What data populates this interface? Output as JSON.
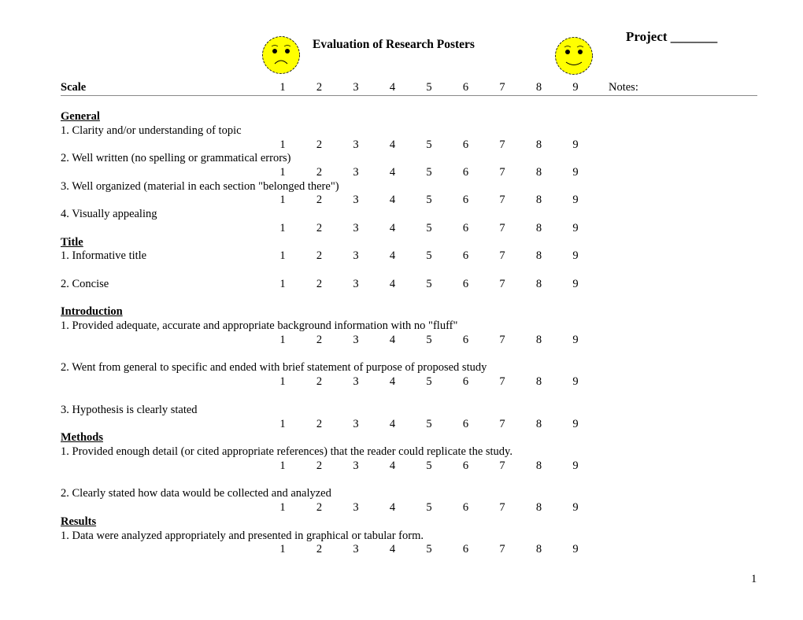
{
  "header": {
    "title": "Evaluation of Research Posters",
    "project_label": "Project _______",
    "sad_face_icon": "frowning-face",
    "happy_face_icon": "smiling-face"
  },
  "scale_row": {
    "label": "Scale",
    "values": [
      "1",
      "2",
      "3",
      "4",
      "5",
      "6",
      "7",
      "8",
      "9"
    ],
    "notes_label": "Notes:"
  },
  "sections": {
    "general": {
      "heading": "General",
      "items": [
        "1. Clarity and/or understanding of topic",
        "2. Well written (no spelling or grammatical errors)",
        "3. Well organized (material in each section \"belonged there\")",
        "4. Visually appealing"
      ]
    },
    "title": {
      "heading": "Title",
      "items": [
        "1. Informative title",
        "2. Concise"
      ]
    },
    "introduction": {
      "heading": "Introduction",
      "items": [
        "1. Provided adequate, accurate and appropriate background information with no \"fluff\"",
        "2. Went from general to specific and ended with brief statement of purpose of proposed study",
        "3. Hypothesis is clearly stated"
      ]
    },
    "methods": {
      "heading": "Methods",
      "items": [
        "1.  Provided enough detail (or cited appropriate references) that the reader could replicate the study.",
        "2.  Clearly stated how data would be collected and analyzed"
      ]
    },
    "results": {
      "heading": "Results",
      "items": [
        "1. Data were analyzed appropriately and presented in graphical or tabular form."
      ]
    }
  },
  "rating_scale": [
    "1",
    "2",
    "3",
    "4",
    "5",
    "6",
    "7",
    "8",
    "9"
  ],
  "footer": {
    "page_number": "1"
  },
  "colors": {
    "face_fill": "#ffff00",
    "rule": "#888888"
  }
}
